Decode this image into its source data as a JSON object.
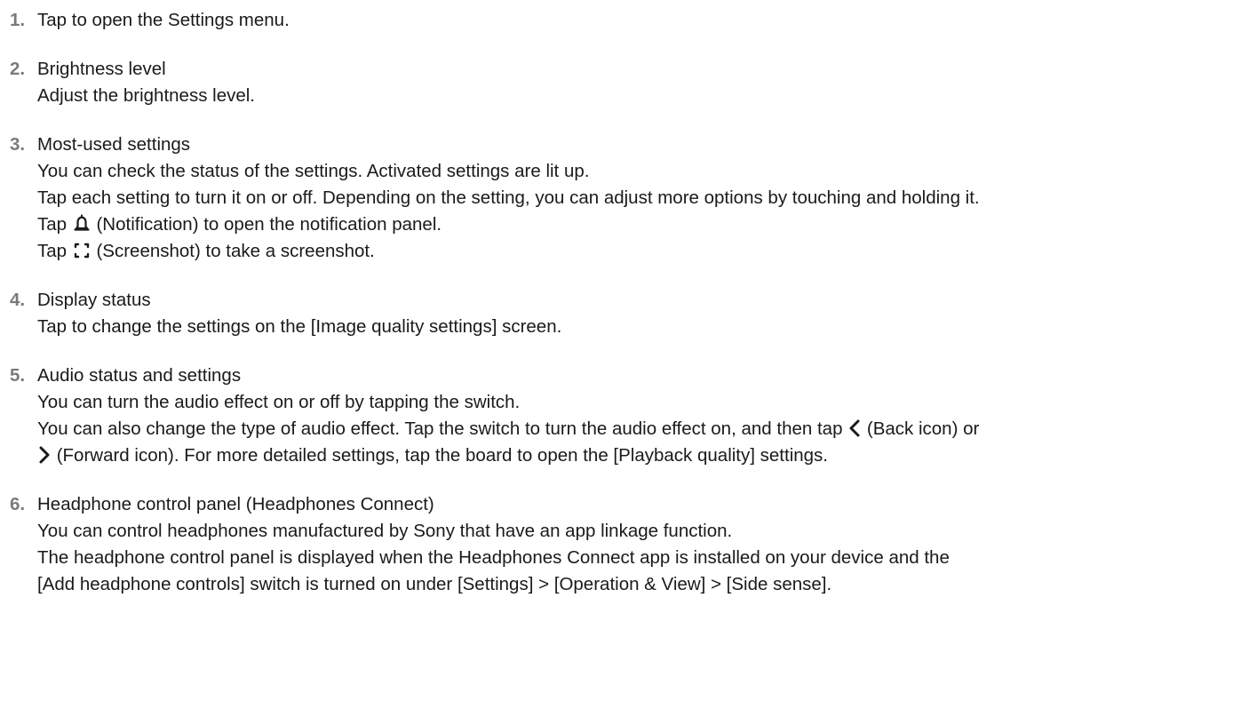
{
  "items": [
    {
      "number": "1.",
      "title": "Tap to open the Settings menu."
    },
    {
      "number": "2.",
      "title": "Brightness level",
      "desc": "Adjust the brightness level."
    },
    {
      "number": "3.",
      "title": "Most-used settings",
      "line1": "You can check the status of the settings. Activated settings are lit up.",
      "line2": "Tap each setting to turn it on or off. Depending on the setting, you can adjust more options by touching and holding it.",
      "notif_pre": "Tap",
      "notif_post": "(Notification) to open the notification panel.",
      "shot_pre": "Tap",
      "shot_post": "(Screenshot) to take a screenshot."
    },
    {
      "number": "4.",
      "title": "Display status",
      "desc": "Tap to change the settings on the [Image quality settings] screen."
    },
    {
      "number": "5.",
      "title": "Audio status and settings",
      "line1": "You can turn the audio effect on or off by tapping the switch.",
      "line2_pre": "You can also change the type of audio effect. Tap the switch to turn the audio effect on, and then tap",
      "line2_post": "(Back icon) or",
      "line3_post": "(Forward icon). For more detailed settings, tap the board to open the [Playback quality] settings."
    },
    {
      "number": "6.",
      "title": "Headphone control panel (Headphones Connect)",
      "line1": "You can control headphones manufactured by Sony that have an app linkage function.",
      "line2": "The headphone control panel is displayed when the Headphones Connect app is installed on your device and the",
      "line3": "[Add headphone controls] switch is turned on under [Settings] > [Operation & View] > [Side sense]."
    }
  ],
  "icons": {
    "notification": "bell-icon",
    "screenshot": "screenshot-icon",
    "back": "chevron-left-icon",
    "forward": "chevron-right-icon"
  }
}
